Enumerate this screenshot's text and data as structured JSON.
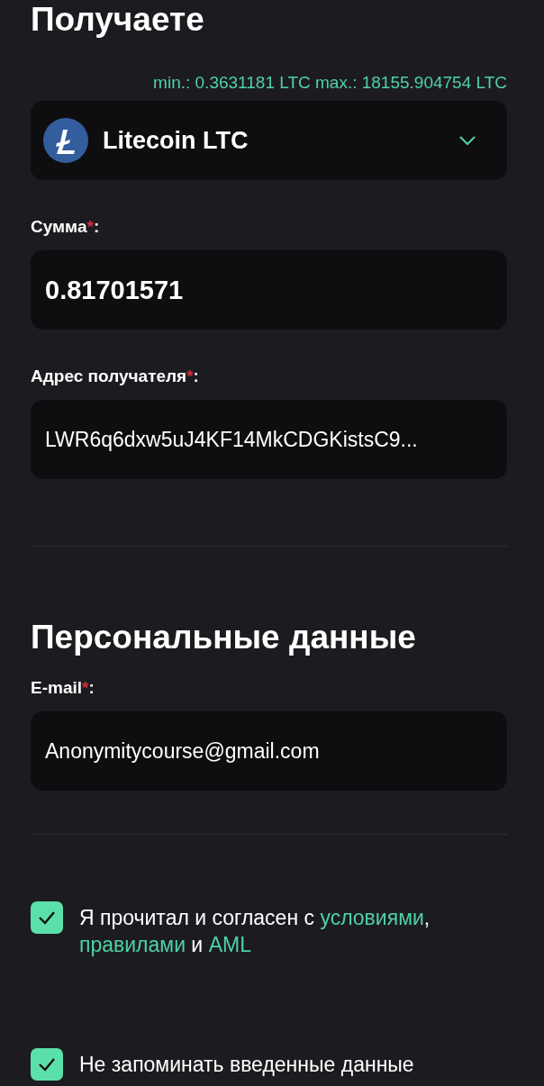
{
  "receive": {
    "title": "Получаете",
    "limits": "min.: 0.3631181 LTC max.: 18155.904754 LTC",
    "currency": {
      "name": "Litecoin LTC",
      "expanded": false
    },
    "fields": [
      {
        "label": "Сумма",
        "required_mark": "*",
        "colon": ":",
        "value": "0.81701571",
        "kind": "amount"
      },
      {
        "label": "Адрес получателя",
        "required_mark": "*",
        "colon": ":",
        "value": "LWR6q6dxw5uJ4KF14MkCDGKistsC9...",
        "kind": "text"
      }
    ]
  },
  "personal": {
    "title": "Персональные данные",
    "fields": [
      {
        "label": "E-mail",
        "required_mark": "*",
        "colon": ":",
        "value": "Anonymitycourse@gmail.com",
        "kind": "text"
      }
    ]
  },
  "agreements": [
    {
      "checked": true,
      "parts": [
        {
          "kind": "text",
          "text": "Я прочитал и согласен с "
        },
        {
          "kind": "link",
          "text": "условиями"
        },
        {
          "kind": "text",
          "text": ", "
        },
        {
          "kind": "link",
          "text": "правилами"
        },
        {
          "kind": "text",
          "text": " и "
        },
        {
          "kind": "link",
          "text": "AML"
        }
      ]
    },
    {
      "checked": true,
      "parts": [
        {
          "kind": "text",
          "text": "Не запоминать введенные данные"
        }
      ]
    }
  ]
}
